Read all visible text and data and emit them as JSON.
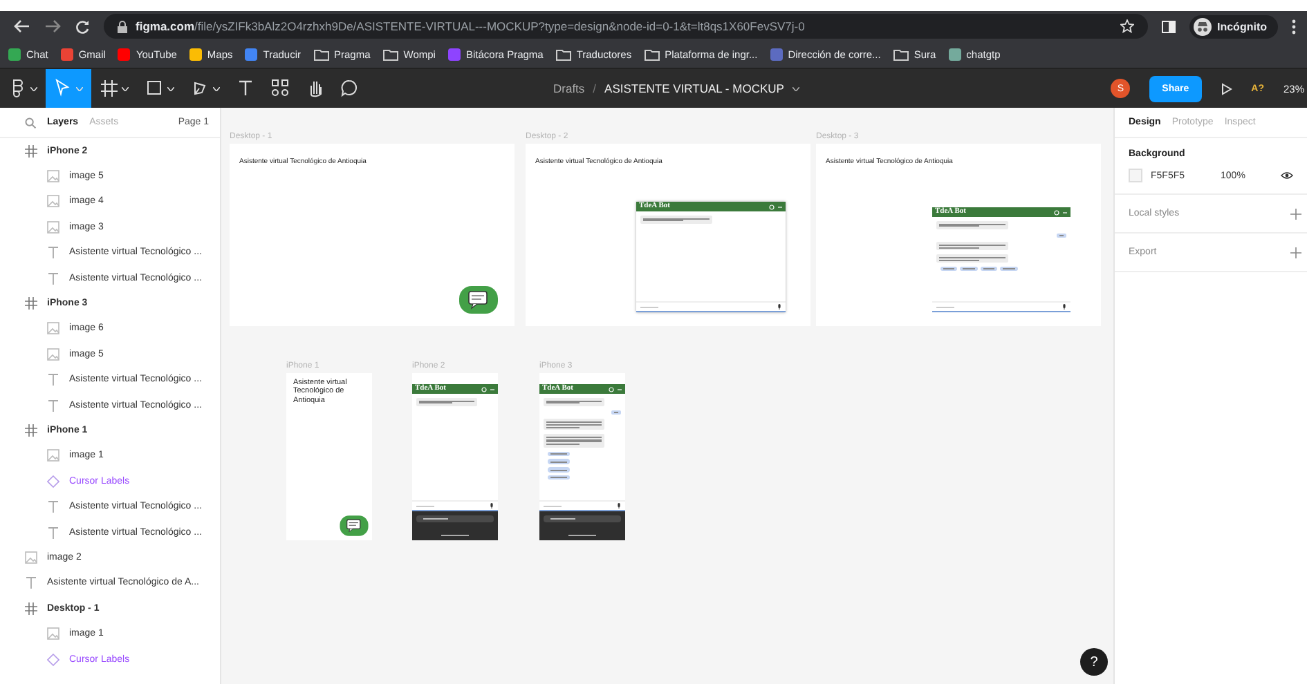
{
  "browser": {
    "url_domain": "figma.com",
    "url_path": "/file/ysZIFk3bAlz2O4rzhxh9De/ASISTENTE-VIRTUAL---MOCKUP?type=design&node-id=0-1&t=lt8qs1X60FevSV7j-0",
    "profile": "Incógnito",
    "bookmarks": [
      {
        "label": "Chat",
        "kind": "site",
        "color": "#34a853"
      },
      {
        "label": "Gmail",
        "kind": "site",
        "color": "#ea4335"
      },
      {
        "label": "YouTube",
        "kind": "site",
        "color": "#ff0000"
      },
      {
        "label": "Maps",
        "kind": "site",
        "color": "#fbbc04"
      },
      {
        "label": "Traducir",
        "kind": "site",
        "color": "#4285f4"
      },
      {
        "label": "Pragma",
        "kind": "folder"
      },
      {
        "label": "Wompi",
        "kind": "folder"
      },
      {
        "label": "Bitácora Pragma",
        "kind": "site",
        "color": "#8e44ff"
      },
      {
        "label": "Traductores",
        "kind": "folder"
      },
      {
        "label": "Plataforma de ingr...",
        "kind": "folder"
      },
      {
        "label": "Dirección de corre...",
        "kind": "site",
        "color": "#5c6bc0"
      },
      {
        "label": "Sura",
        "kind": "folder"
      },
      {
        "label": "chatgtp",
        "kind": "site",
        "color": "#74aa9c"
      }
    ]
  },
  "toolbar": {
    "tools": [
      {
        "kind": "main",
        "selected": false
      },
      {
        "kind": "move",
        "selected": true
      },
      {
        "kind": "frame",
        "selected": false
      },
      {
        "kind": "shape",
        "selected": false
      },
      {
        "kind": "pen",
        "selected": false
      },
      {
        "kind": "text",
        "selected": false
      },
      {
        "kind": "components",
        "selected": false
      },
      {
        "kind": "hand",
        "selected": false
      },
      {
        "kind": "comment",
        "selected": false
      }
    ],
    "breadcrumb": "Drafts",
    "separator": "/",
    "file_title": "ASISTENTE VIRTUAL - MOCKUP",
    "avatar": "S",
    "share": "Share",
    "ai": "A?",
    "zoom": "23%"
  },
  "layers_panel": {
    "tabs": [
      {
        "label": "Layers",
        "selected": true
      },
      {
        "label": "Assets",
        "selected": false
      }
    ],
    "page": "Page 1",
    "layers": [
      {
        "name": "iPhone 2",
        "kind": "frame",
        "children": [
          {
            "name": "image 5",
            "kind": "image"
          },
          {
            "name": "image 4",
            "kind": "image"
          },
          {
            "name": "image 3",
            "kind": "image"
          },
          {
            "name": "Asistente virtual Tecnológico ...",
            "kind": "text"
          },
          {
            "name": "Asistente virtual Tecnológico ...",
            "kind": "text"
          }
        ]
      },
      {
        "name": "iPhone 3",
        "kind": "frame",
        "children": [
          {
            "name": "image 6",
            "kind": "image"
          },
          {
            "name": "image 5",
            "kind": "image"
          },
          {
            "name": "Asistente virtual Tecnológico ...",
            "kind": "text"
          },
          {
            "name": "Asistente virtual Tecnológico ...",
            "kind": "text"
          }
        ]
      },
      {
        "name": "iPhone 1",
        "kind": "frame",
        "children": [
          {
            "name": "image 1",
            "kind": "image"
          },
          {
            "name": "Cursor Labels",
            "kind": "component"
          },
          {
            "name": "Asistente virtual Tecnológico ...",
            "kind": "text"
          },
          {
            "name": "Asistente virtual Tecnológico ...",
            "kind": "text"
          }
        ]
      },
      {
        "name": "image 2",
        "kind": "image"
      },
      {
        "name": "Asistente virtual Tecnológico de A...",
        "kind": "text"
      },
      {
        "name": "Desktop - 1",
        "kind": "frame",
        "children": [
          {
            "name": "image 1",
            "kind": "image"
          },
          {
            "name": "Cursor Labels",
            "kind": "component"
          }
        ]
      }
    ]
  },
  "canvas": {
    "frames": [
      {
        "label": "Desktop - 1",
        "kind": "desktop_launcher",
        "heading": "Asistente virtual Tecnológico de Antioquia"
      },
      {
        "label": "Desktop - 2",
        "kind": "desktop_chat",
        "heading": "Asistente virtual Tecnológico de Antioquia",
        "bot_title": "TdeA Bot"
      },
      {
        "label": "Desktop - 3",
        "kind": "desktop_conversation",
        "heading": "Asistente virtual Tecnológico de Antioquia",
        "bot_title": "TdeA Bot"
      },
      {
        "label": "iPhone 1",
        "kind": "phone_launcher",
        "heading": "Asistente virtual Tecnológico de Antioquia"
      },
      {
        "label": "iPhone 2",
        "kind": "phone_chat",
        "bot_title": "TdeA Bot"
      },
      {
        "label": "iPhone 3",
        "kind": "phone_conversation",
        "bot_title": "TdeA Bot"
      }
    ]
  },
  "design_panel": {
    "tabs": [
      {
        "label": "Design",
        "selected": true
      },
      {
        "label": "Prototype",
        "selected": false
      },
      {
        "label": "Inspect",
        "selected": false
      }
    ],
    "background": {
      "title": "Background",
      "color": "#f5f5f5",
      "hex": "F5F5F5",
      "opacity": "100%"
    },
    "sections": [
      "Local styles",
      "Export"
    ]
  },
  "help": "?"
}
